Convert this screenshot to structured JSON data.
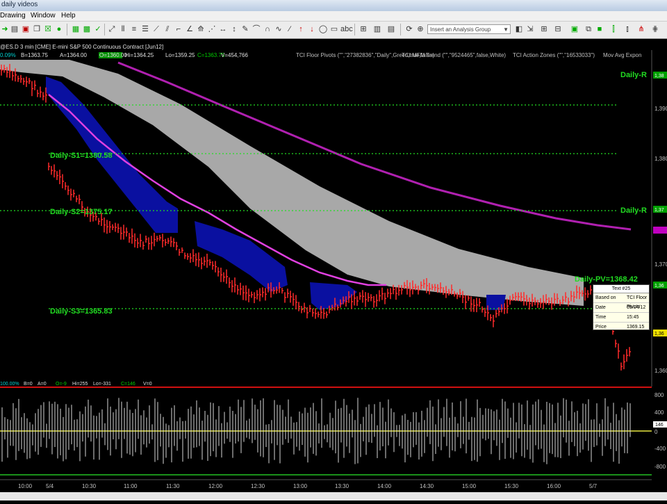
{
  "window": {
    "title": "daily videos"
  },
  "menu": [
    "Drawing",
    "Window",
    "Help"
  ],
  "toolbar": {
    "analysis_group_placeholder": "Insert an Analysis Group"
  },
  "price_panel": {
    "data_line": [
      "0.09%",
      "B=1363.75",
      "A=1364.00",
      "O=1360.00",
      "Hi=1364.25",
      "Lo=1359.25",
      "C=1363.75",
      "V=454,766"
    ],
    "symbol": "@ES.D 3 min [CME] E-mini S&P 500 Continuous Contract [Jun12]",
    "studies": [
      "TCI Floor Pivots (\"\",\"27382836\",\"Daily\",Green,true,false)",
      "TCI MFM Trend (\"\",\"9524465\",false,White)",
      "TCI Action Zones (\"\",\"16533033\")",
      "Mov Avg Expon"
    ],
    "y_axis_labels": [
      "1,390",
      "1,380",
      "1,370",
      "1,360"
    ],
    "price_badges": [
      {
        "label": "1,38",
        "color": "#00a000"
      },
      {
        "label": "1,37",
        "color": "#00a000"
      },
      {
        "label": "1,36",
        "color": "#00a000"
      },
      {
        "label": "1,36",
        "color": "#f0e000"
      }
    ],
    "pivot_labels": {
      "daily_r_top": "Daily-R",
      "daily_r_mid": "Daily-R",
      "s1": "Daily-S1=1380.58",
      "s2": "Daily-S2=1375.17",
      "s3": "Daily-S3=1365.83",
      "pv": "Daily-PV=1368.42"
    },
    "pivots": {
      "s1": 1380.58,
      "s2": 1375.17,
      "s3": 1365.83,
      "pv": 1368.42
    },
    "colors": {
      "pivot": "#22dd22",
      "bars": "#ff2a2a",
      "zone": "#0a10a0",
      "ribbon": "#a8a8a8",
      "ema_fast": "#e040e0",
      "ema_slow": "#b020b0"
    }
  },
  "tooltip": {
    "title": "Text #25",
    "rows": [
      {
        "k": "Based on",
        "v": "TCI Floor Pivots"
      },
      {
        "k": "Date",
        "v": "05/04/12"
      },
      {
        "k": "Time",
        "v": "15:45"
      },
      {
        "k": "Price",
        "v": "1369.15"
      }
    ]
  },
  "oscillator_panel": {
    "data_line": [
      "100.00%",
      "B=0",
      "A=0",
      "O=-9",
      "Hi=255",
      "Lo=-331",
      "C=146",
      "V=0"
    ],
    "y_axis_labels": [
      "800",
      "400",
      "0",
      "-400",
      "-800"
    ],
    "current_badge": "146"
  },
  "x_axis_labels": [
    "10:00",
    "5/4",
    "10:30",
    "11:00",
    "11:30",
    "12:00",
    "12:30",
    "13:00",
    "13:30",
    "14:00",
    "14:30",
    "15:00",
    "15:30",
    "16:00",
    "5/7"
  ]
}
